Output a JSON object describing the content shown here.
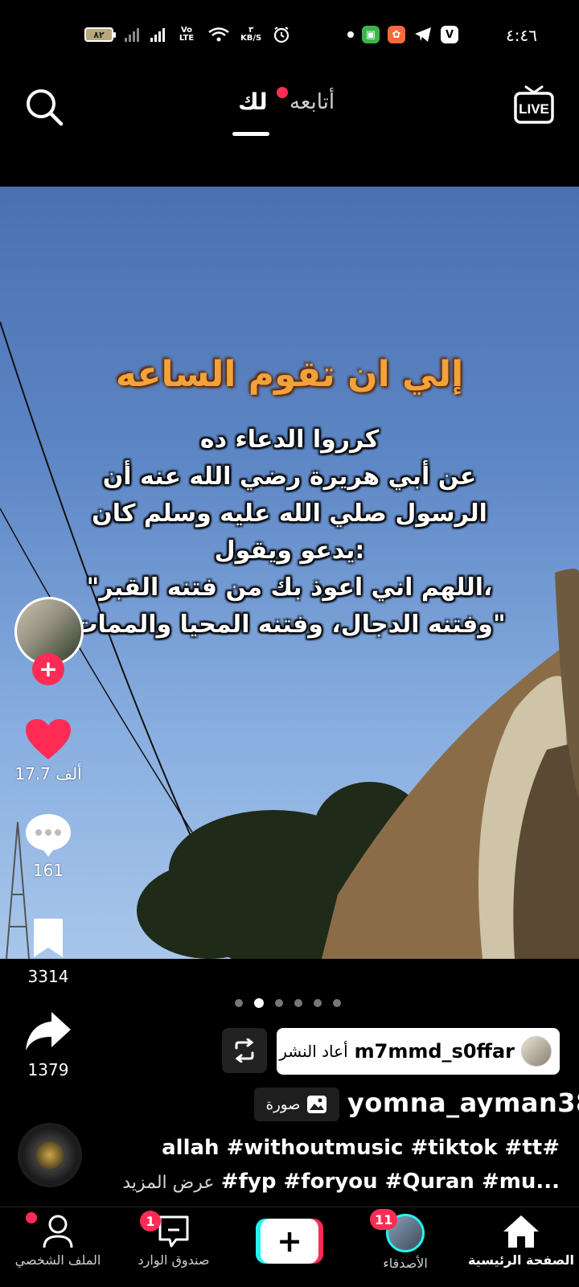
{
  "status_bar": {
    "time": "٤:٤٦",
    "battery": "٨٢",
    "network_speed_value": "٣",
    "network_speed_unit": "KB/S",
    "volte": "Vo LTE"
  },
  "top_nav": {
    "tab_following": "أتابعه",
    "tab_for_you": "لك",
    "live_label": "LIVE"
  },
  "video": {
    "overlay_title": "إلي ان تقوم الساعه",
    "overlay_lines": [
      "كرروا الدعاء ده",
      "عن أبي هريرة رضي الله عنه أن",
      "الرسول صلي الله عليه وسلم كان",
      "يدعو ويقول:",
      "\"اللهم اني اعوذ بك من فتنه القبر،",
      "وفتنه الدجال، وفتنه المحيا والممات\""
    ]
  },
  "actions": {
    "likes": "17.7 ألف",
    "comments": "161",
    "saves": "3314",
    "shares": "1379"
  },
  "carousel": {
    "count": 6,
    "active_index": 1
  },
  "repost": {
    "user": "m7mmd_s0ffar",
    "label": "أعاد النشر"
  },
  "post": {
    "photo_label": "صورة",
    "username": "yomna_ayman38",
    "caption_line1": "allah #withoutmusic #tiktok #tt#",
    "caption_line2_tags": "#fyp #foryou #Quran #mu...",
    "see_more": "عرض المزيد"
  },
  "bottom_nav": {
    "home": "الصفحة الرئيسية",
    "friends": "الأصدقاء",
    "friends_badge": "11",
    "inbox": "صندوق الوارد",
    "inbox_badge": "1",
    "profile": "الملف الشخصي"
  },
  "colors": {
    "accent_red": "#fe2c55",
    "accent_cyan": "#25f4ee",
    "overlay_title": "#f2a23a"
  }
}
